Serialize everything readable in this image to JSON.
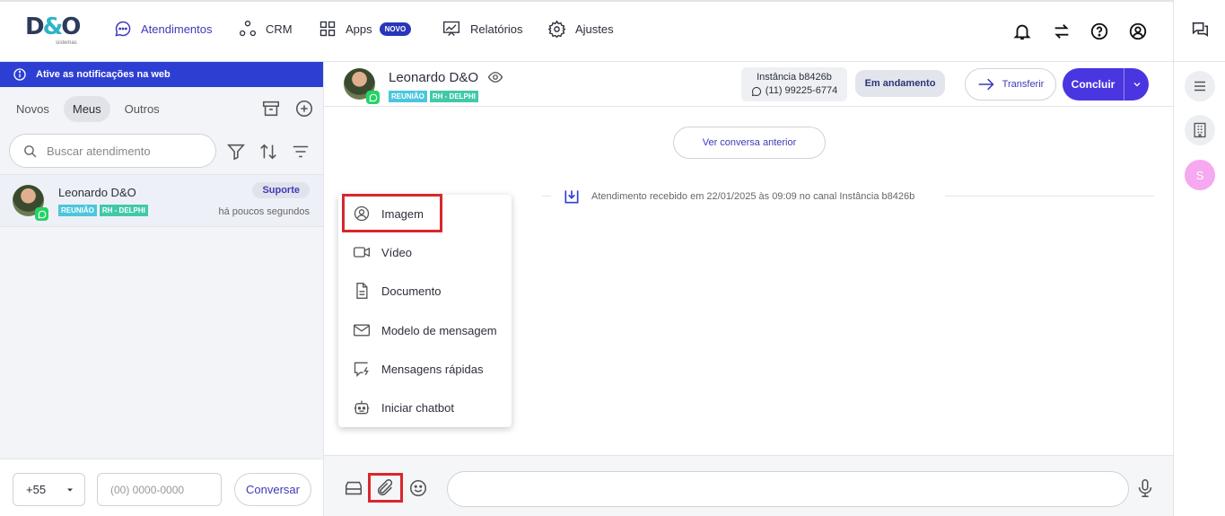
{
  "brand": {
    "logo_text": "D&O",
    "logo_sub": "sistemas"
  },
  "nav": {
    "items": [
      {
        "label": "Atendimentos",
        "icon": "chat-bubble-icon",
        "active": true
      },
      {
        "label": "CRM",
        "icon": "nodes-icon"
      },
      {
        "label": "Apps",
        "icon": "grid-icon",
        "badge": "NOVO"
      },
      {
        "label": "Relatórios",
        "icon": "chart-board-icon"
      },
      {
        "label": "Ajustes",
        "icon": "gear-icon"
      }
    ]
  },
  "notice": {
    "text": "Ative as notificações na web"
  },
  "tabs": [
    {
      "label": "Novos"
    },
    {
      "label": "Meus",
      "active": true
    },
    {
      "label": "Outros"
    }
  ],
  "search": {
    "placeholder": "Buscar atendimento"
  },
  "conversation": {
    "name": "Leonardo D&O",
    "tags": [
      "REUNIÃO",
      "RH - DELPHI"
    ],
    "queue": "Suporte",
    "time": "há poucos segundos"
  },
  "new_chat": {
    "ddi": "+55",
    "phone_placeholder": "(00) 0000-0000",
    "button": "Conversar"
  },
  "chat_header": {
    "name": "Leonardo D&O",
    "tags": [
      "REUNIÃO",
      "RH - DELPHI"
    ],
    "instance_name": "Instância b8426b",
    "instance_phone": "(11) 99225-6774",
    "status": "Em andamento",
    "transfer_label": "Transferir",
    "conclude_label": "Concluir"
  },
  "chat": {
    "previous_button": "Ver conversa anterior",
    "system_message": "Atendimento recebido em 22/01/2025 às 09:09 no canal Instância b8426b"
  },
  "attach_menu": {
    "items": [
      {
        "label": "Imagem",
        "icon": "image-user-icon",
        "highlighted": true
      },
      {
        "label": "Vídeo",
        "icon": "video-icon"
      },
      {
        "label": "Documento",
        "icon": "document-icon"
      },
      {
        "label": "Modelo de mensagem",
        "icon": "envelope-icon"
      },
      {
        "label": "Mensagens rápidas",
        "icon": "quick-message-icon"
      },
      {
        "label": "Iniciar chatbot",
        "icon": "robot-icon"
      }
    ]
  },
  "rail": {
    "avatar_letter": "S"
  },
  "colors": {
    "primary": "#4a36e0",
    "nav_active": "#3f3ab8",
    "notice_bg": "#2d3fd3",
    "highlight": "#d8272d",
    "tag_blue": "#4cc6dc",
    "tag_green": "#42c9a8"
  }
}
